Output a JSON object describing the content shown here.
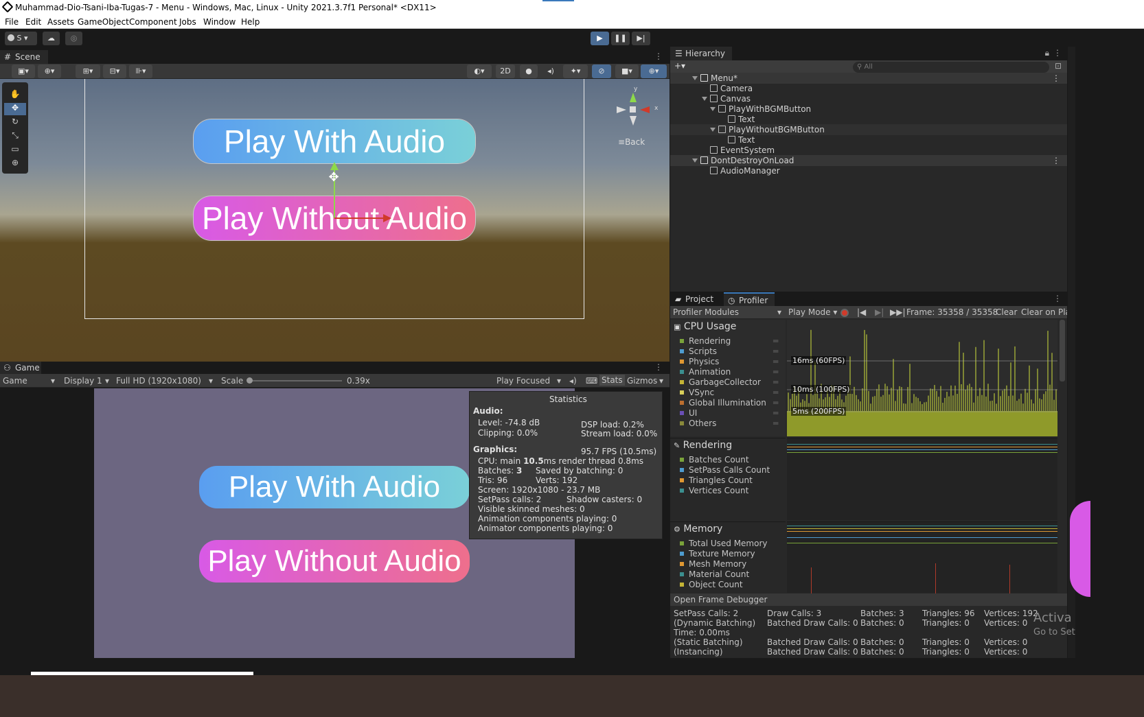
{
  "window": {
    "title": "Muhammad-Dio-Tsani-Iba-Tugas-7 - Menu - Windows, Mac, Linux - Unity 2021.3.7f1 Personal* <DX11>"
  },
  "menu": [
    "File",
    "Edit",
    "Assets",
    "GameObject",
    "Component",
    "Jobs",
    "Window",
    "Help"
  ],
  "toolbar": {
    "account": "S"
  },
  "scene": {
    "tab": "Scene",
    "mode_2d": "2D",
    "gizmo_y": "y",
    "gizmo_x": "x",
    "back_label": "Back",
    "button1": "Play With Audio",
    "button2": "Play Without Audio"
  },
  "hierarchy": {
    "tab": "Hierarchy",
    "search_placeholder": "All",
    "items": [
      {
        "label": "Menu*"
      },
      {
        "label": "Camera"
      },
      {
        "label": "Canvas"
      },
      {
        "label": "PlayWithBGMButton"
      },
      {
        "label": "Text"
      },
      {
        "label": "PlayWithoutBGMButton"
      },
      {
        "label": "Text"
      },
      {
        "label": "EventSystem"
      },
      {
        "label": "DontDestroyOnLoad"
      },
      {
        "label": "AudioManager"
      }
    ]
  },
  "game": {
    "tab": "Game",
    "view_select": "Game",
    "display": "Display 1",
    "resolution": "Full HD (1920x1080)",
    "scale_label": "Scale",
    "scale_value": "0.39x",
    "scale_fraction": 0.0,
    "play_focused": "Play Focused",
    "stats": "Stats",
    "gizmos": "Gizmos",
    "button1": "Play With Audio",
    "button2": "Play Without Audio"
  },
  "statistics": {
    "title": "Statistics",
    "audio_header": "Audio:",
    "level": "Level: -74.8 dB",
    "clipping": "Clipping: 0.0%",
    "dsp_load": "DSP load: 0.2%",
    "stream_load": "Stream load: 0.0%",
    "graphics_header": "Graphics:",
    "fps": "95.7 FPS (10.5ms)",
    "cpu_prefix": "CPU: main ",
    "cpu_main": "10.5",
    "cpu_suffix": "ms  render thread 0.8ms",
    "batches_prefix": "Batches: ",
    "batches_value": "3",
    "saved_batching": "Saved by batching: 0",
    "tris": "Tris: 96",
    "verts": "Verts: 192",
    "screen": "Screen: 1920x1080 - 23.7 MB",
    "setpass": "SetPass calls: 2",
    "shadow_casters": "Shadow casters: 0",
    "skinned": "Visible skinned meshes: 0",
    "animation": "Animation components playing: 0",
    "animator": "Animator components playing: 0"
  },
  "profiler": {
    "tabs": [
      "Project",
      "Profiler"
    ],
    "modules_label": "Profiler Modules",
    "play_mode": "Play Mode",
    "frame": "Frame: 35358 / 35358",
    "clear": "Clear",
    "clear_on_play": "Clear on Play",
    "cpu_header": "CPU Usage",
    "cpu_items": [
      {
        "label": "Rendering",
        "color": "#7aa33a"
      },
      {
        "label": "Scripts",
        "color": "#4e9cd0"
      },
      {
        "label": "Physics",
        "color": "#e09832"
      },
      {
        "label": "Animation",
        "color": "#3b8f8f"
      },
      {
        "label": "GarbageCollector",
        "color": "#c4b435"
      },
      {
        "label": "VSync",
        "color": "#d8cf5a"
      },
      {
        "label": "Global Illumination",
        "color": "#bd6f2f"
      },
      {
        "label": "UI",
        "color": "#6a4fb6"
      },
      {
        "label": "Others",
        "color": "#8a8a3a"
      }
    ],
    "cpu_markers": [
      "16ms (60FPS)",
      "10ms (100FPS)",
      "5ms (200FPS)"
    ],
    "rendering_header": "Rendering",
    "rendering_items": [
      {
        "label": "Batches Count",
        "color": "#7aa33a"
      },
      {
        "label": "SetPass Calls Count",
        "color": "#4e9cd0"
      },
      {
        "label": "Triangles Count",
        "color": "#e09832"
      },
      {
        "label": "Vertices Count",
        "color": "#3b8f8f"
      }
    ],
    "memory_header": "Memory",
    "memory_items": [
      {
        "label": "Total Used Memory",
        "color": "#7aa33a"
      },
      {
        "label": "Texture Memory",
        "color": "#4e9cd0"
      },
      {
        "label": "Mesh Memory",
        "color": "#e09832"
      },
      {
        "label": "Material Count",
        "color": "#3b8f8f"
      },
      {
        "label": "Object Count",
        "color": "#c4b435"
      }
    ],
    "frame_debugger": "Open Frame Debugger",
    "details": {
      "c1": [
        "SetPass Calls: 2",
        "(Dynamic Batching)",
        "Time: 0.00ms",
        "(Static Batching)",
        "(Instancing)"
      ],
      "c2": [
        "Draw Calls: 3",
        "Batched Draw Calls: 0",
        "",
        "Batched Draw Calls: 0",
        "Batched Draw Calls: 0"
      ],
      "c3": [
        "Batches: 3",
        "Batches: 0",
        "",
        "Batches: 0",
        "Batches: 0"
      ],
      "c4": [
        "Triangles: 96",
        "Triangles: 0",
        "",
        "Triangles: 0",
        "Triangles: 0"
      ],
      "c5": [
        "Vertices: 192",
        "Vertices: 0",
        "",
        "Vertices: 0",
        "Vertices: 0"
      ]
    }
  },
  "watermark": {
    "line1": "Activa",
    "line2": "Go to Set"
  }
}
